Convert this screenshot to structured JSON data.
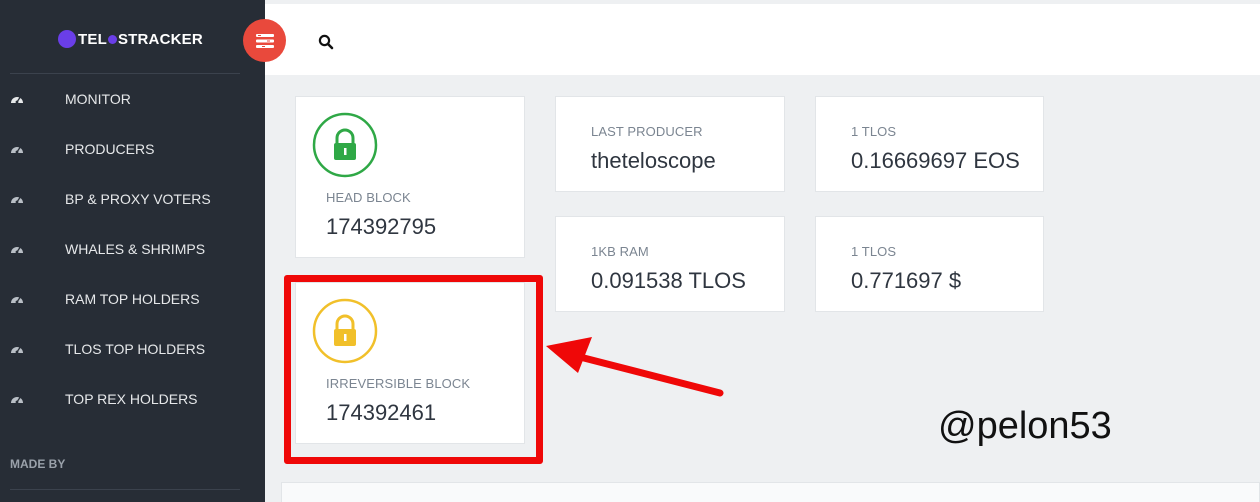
{
  "app": {
    "brand_prefix": "TEL",
    "brand_suffix": "STRACKER"
  },
  "sidebar": {
    "items": [
      {
        "label": "MONITOR",
        "icon": "dashboard-icon"
      },
      {
        "label": "PRODUCERS",
        "icon": "dashboard-icon"
      },
      {
        "label": "BP & PROXY VOTERS",
        "icon": "dashboard-icon"
      },
      {
        "label": "WHALES & SHRIMPS",
        "icon": "dashboard-icon"
      },
      {
        "label": "RAM TOP HOLDERS",
        "icon": "dashboard-icon"
      },
      {
        "label": "TLOS TOP HOLDERS",
        "icon": "dashboard-icon"
      },
      {
        "label": "TOP REX HOLDERS",
        "icon": "dashboard-icon"
      }
    ],
    "made_by": "MADE BY"
  },
  "cards": {
    "head_block": {
      "label": "HEAD BLOCK",
      "value": "174392795",
      "icon": "lock-icon",
      "icon_color": "#2fa846"
    },
    "irreversible_block": {
      "label": "IRREVERSIBLE BLOCK",
      "value": "174392461",
      "icon": "lock-icon",
      "icon_color": "#f1c02a"
    },
    "last_producer": {
      "label": "LAST PRODUCER",
      "value": "theteloscope"
    },
    "tlos_eos": {
      "label": "1 TLOS",
      "value": "0.16669697 EOS"
    },
    "ram_price": {
      "label": "1KB RAM",
      "value": "0.091538 TLOS"
    },
    "tlos_usd": {
      "label": "1 TLOS",
      "value": "0.771697 $"
    }
  },
  "annotation": {
    "watermark": "@pelon53",
    "highlight_color": "#ef0808"
  },
  "colors": {
    "sidebar_bg": "#272d36",
    "accent_red": "#e9493c",
    "brand_purple": "#6a3ee8",
    "main_bg": "#eef0f2"
  }
}
